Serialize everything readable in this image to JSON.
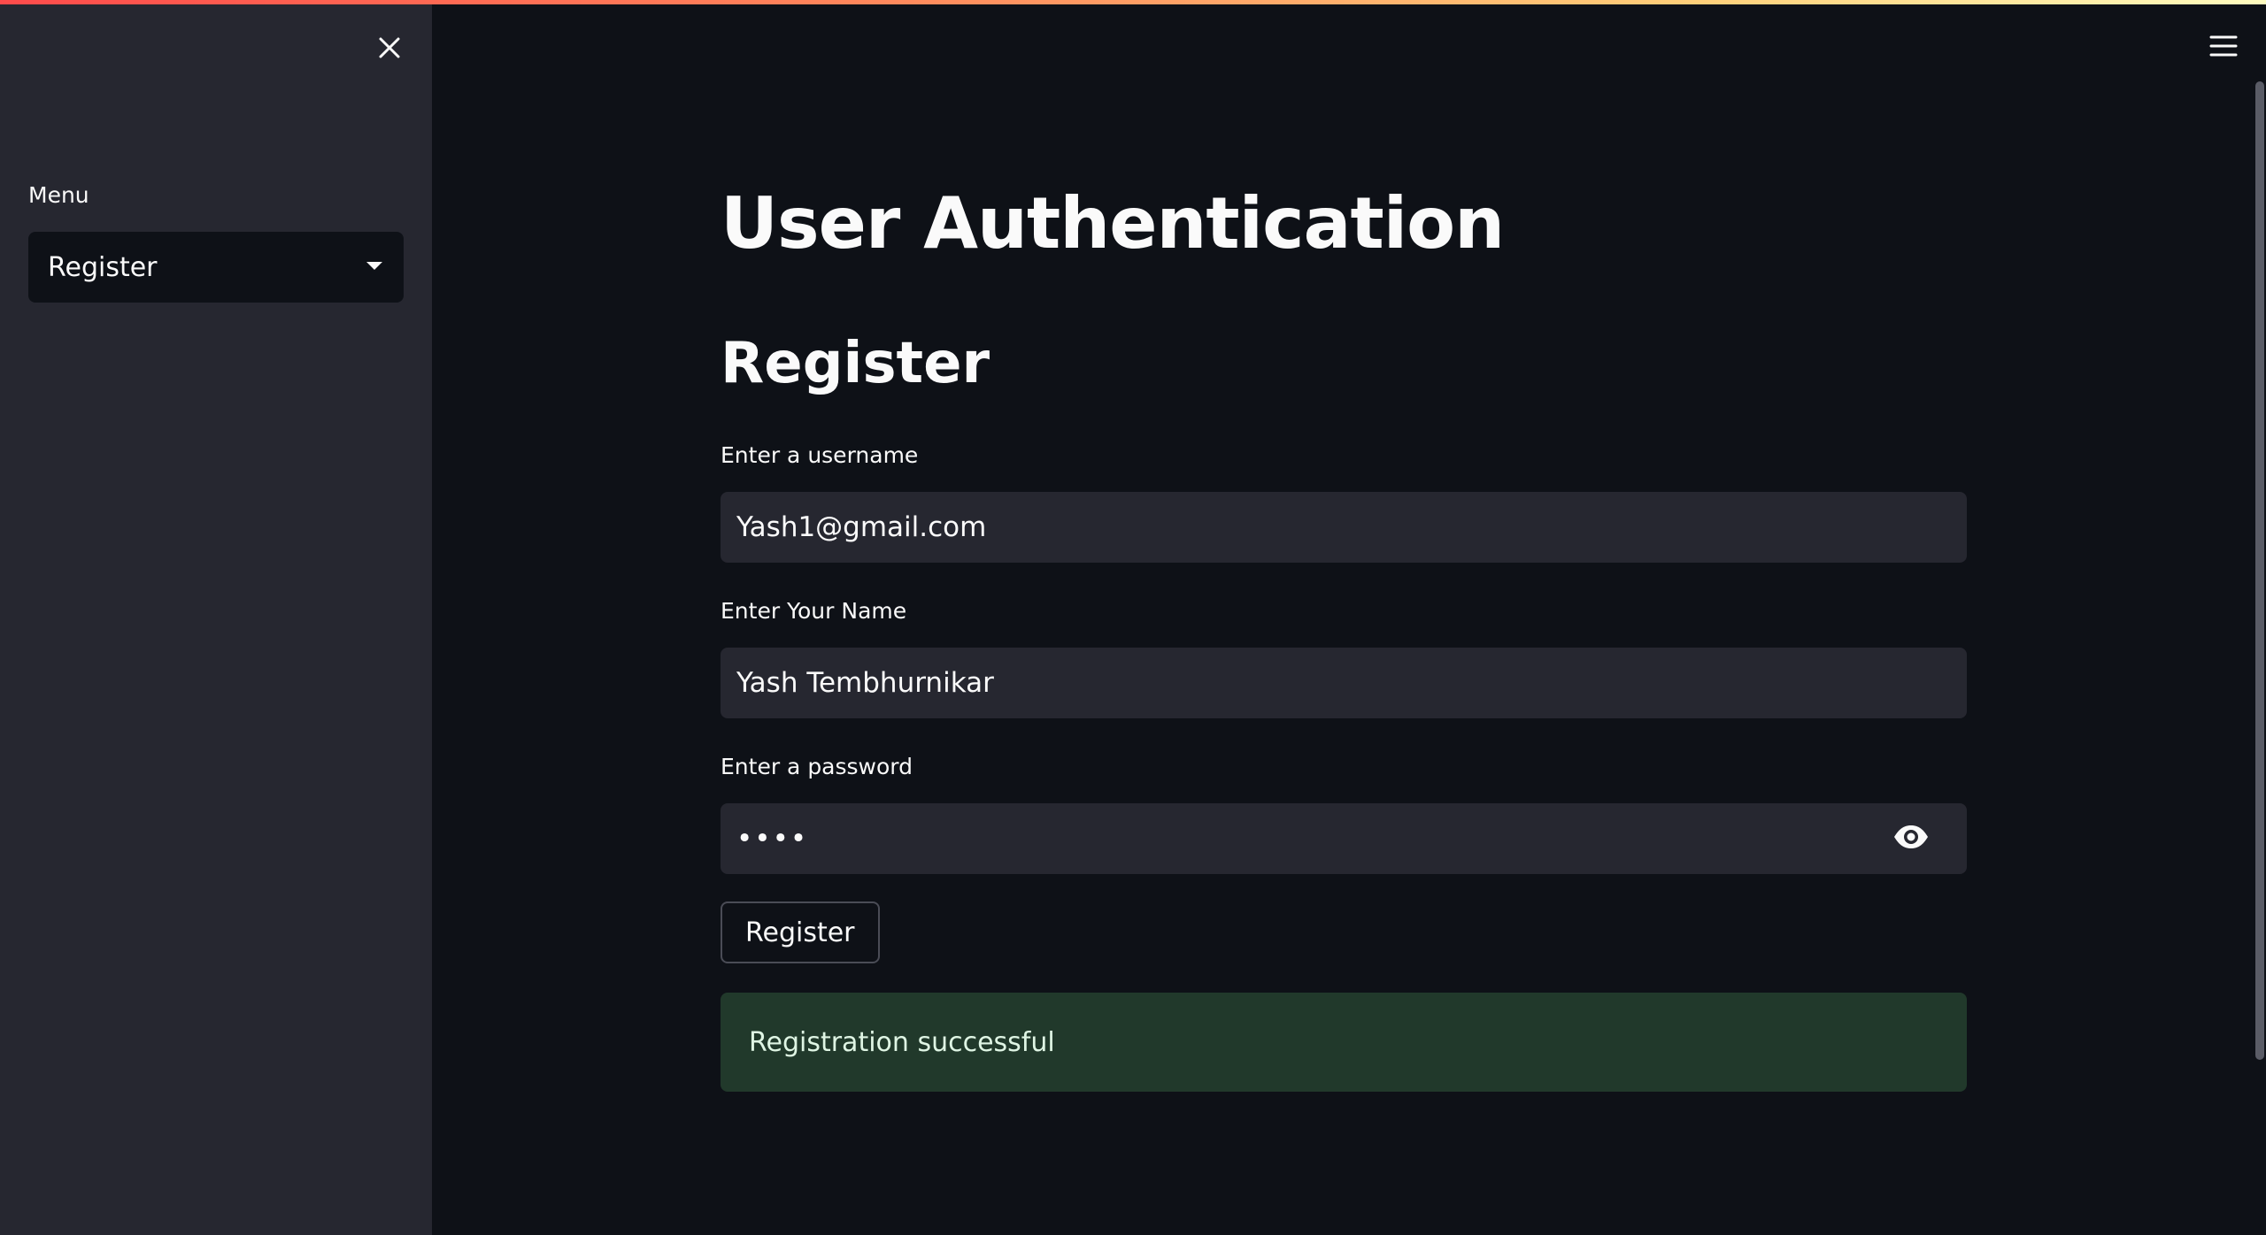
{
  "sidebar": {
    "close_icon": "close-icon",
    "menu_label": "Menu",
    "menu_selected": "Register",
    "dropdown_icon": "caret-down-icon"
  },
  "header": {
    "menu_icon": "hamburger-icon"
  },
  "main": {
    "title": "User Authentication",
    "section_title": "Register",
    "username": {
      "label": "Enter a username",
      "value": "Yash1@gmail.com"
    },
    "name": {
      "label": "Enter Your Name",
      "value": "Yash Tembhurnikar"
    },
    "password": {
      "label": "Enter a password",
      "value": "abcd",
      "toggle_icon": "eye-icon"
    },
    "register_button": "Register",
    "success_message": "Registration successful"
  },
  "colors": {
    "background": "#0e1117",
    "sidebar": "#262730",
    "input": "#262730",
    "success_bg": "#21392b",
    "accent": "#ff4b4b"
  }
}
